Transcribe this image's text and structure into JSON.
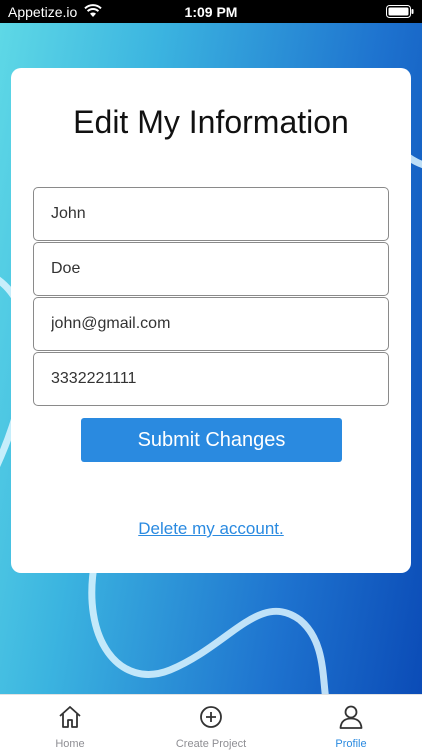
{
  "status_bar": {
    "carrier": "Appetize.io",
    "time": "1:09 PM"
  },
  "form": {
    "title": "Edit My Information",
    "first_name": "John",
    "last_name": "Doe",
    "email": "john@gmail.com",
    "phone": "3332221111",
    "submit_label": "Submit Changes",
    "delete_label": "Delete my account."
  },
  "tab_bar": {
    "items": [
      {
        "label": "Home",
        "icon": "home-icon",
        "active": false
      },
      {
        "label": "Create Project",
        "icon": "plus-circle-icon",
        "active": false
      },
      {
        "label": "Profile",
        "icon": "person-icon",
        "active": true
      }
    ]
  },
  "colors": {
    "accent": "#2a8ae0",
    "gradient_left": "#5fd9e6",
    "gradient_right": "#0a49b5"
  }
}
